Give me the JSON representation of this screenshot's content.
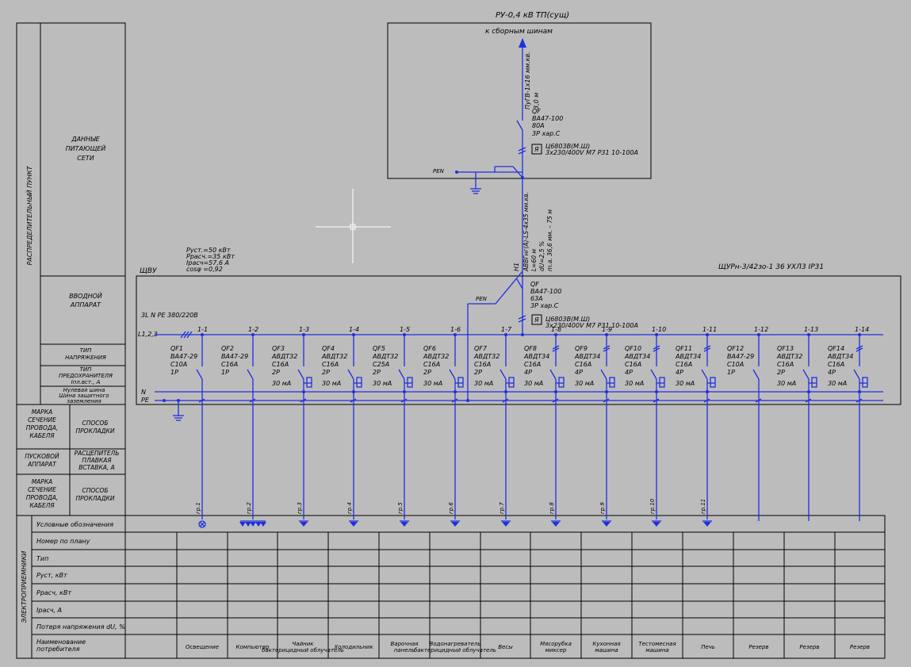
{
  "colors": {
    "background": "#bcbcbc",
    "line": "#000000",
    "network": "#1f2fe0",
    "cursor": "#ffffff"
  },
  "title_block": {
    "ru_title": "РУ-0,4 кВ ТП(сущ)",
    "busbar_label": "к сборным шинам",
    "feed_cable": [
      "ПуГВ-1х16 мм.кв.",
      "3,0 м"
    ],
    "feed_qf": [
      "QF",
      "ВА47-100",
      "80А",
      "3P хар.С"
    ],
    "feed_meter": [
      "Ц6803В(М.Ш)",
      "3х230/400V М7 Р31 10-100А"
    ],
    "pen_top": "PEN",
    "main_cable": [
      "АВВГнг(А)-LS-4х35 мм.кв.",
      "L=60 м",
      "dU=2,5 %",
      "m.a. 36,6 мм. – 75 м"
    ],
    "h1": "H1"
  },
  "load_calc": [
    "Руст.=50 кВт",
    "Ррасч.=35 кВт",
    "Iрасч=57,6 А",
    "cosφ =0,92"
  ],
  "panel": {
    "name": "ЩВУ",
    "type": "ЩУРн-3/42зо-1 36 УХЛ3 IP31",
    "voltage": "3L N PE   380/220В",
    "bus_label": "L1,2,3",
    "n_label": "N",
    "pe_label": "PE",
    "pen": "PEN",
    "input_qf": [
      "QF",
      "ВА47-100",
      "63А",
      "3P хар.С"
    ],
    "input_meter": [
      "Ц6803В(М.Ш)",
      "3х230/400V М7 Р31 10-100А"
    ]
  },
  "feeders": [
    {
      "num": "1-1",
      "qf": "QF1",
      "model": "ВА47-29",
      "rating": "C10A",
      "poles": "1P",
      "ma": "",
      "cable": "гр.1",
      "consumer": "Освещение"
    },
    {
      "num": "1-2",
      "qf": "QF2",
      "model": "ВА47-29",
      "rating": "C16A",
      "poles": "1P",
      "ma": "",
      "cable": "гр.2",
      "consumer": "Компьютер"
    },
    {
      "num": "1-3",
      "qf": "QF3",
      "model": "АВДТ32",
      "rating": "C16A",
      "poles": "2P",
      "ma": "30 мА",
      "cable": "гр.3",
      "consumer": "Чайник, бактерицидный облучатель"
    },
    {
      "num": "1-4",
      "qf": "QF4",
      "model": "АВДТ32",
      "rating": "C16A",
      "poles": "2P",
      "ma": "30 мА",
      "cable": "гр.4",
      "consumer": "Холодильник"
    },
    {
      "num": "1-5",
      "qf": "QF5",
      "model": "АВДТ32",
      "rating": "C25A",
      "poles": "2P",
      "ma": "30 мА",
      "cable": "гр.5",
      "consumer": "Варочная панель"
    },
    {
      "num": "1-6",
      "qf": "QF6",
      "model": "АВДТ32",
      "rating": "C16A",
      "poles": "2P",
      "ma": "30 мА",
      "cable": "гр.6",
      "consumer": "Водонагреватель, бактерицидный облучатель"
    },
    {
      "num": "1-7",
      "qf": "QF7",
      "model": "АВДТ32",
      "rating": "C16A",
      "poles": "2P",
      "ma": "30 мА",
      "cable": "гр.7",
      "consumer": "Весы"
    },
    {
      "num": "1-8",
      "qf": "QF8",
      "model": "АВДТ34",
      "rating": "C16A",
      "poles": "4P",
      "ma": "30 мА",
      "cable": "гр.8",
      "consumer": "Мясорубка, миксер"
    },
    {
      "num": "1-9",
      "qf": "QF9",
      "model": "АВДТ34",
      "rating": "C16A",
      "poles": "4P",
      "ma": "30 мА",
      "cable": "гр.9",
      "consumer": "Кухонная машина"
    },
    {
      "num": "1-10",
      "qf": "QF10",
      "model": "АВДТ34",
      "rating": "C16A",
      "poles": "4P",
      "ma": "30 мА",
      "cable": "гр.10",
      "consumer": "Тестомесная машина"
    },
    {
      "num": "1-11",
      "qf": "QF11",
      "model": "АВДТ34",
      "rating": "C16A",
      "poles": "4P",
      "ma": "30 мА",
      "cable": "гр.11",
      "consumer": "Печь"
    },
    {
      "num": "1-12",
      "qf": "QF12",
      "model": "ВА47-29",
      "rating": "C10A",
      "poles": "1P",
      "ma": "",
      "cable": "",
      "consumer": "Резерв"
    },
    {
      "num": "1-13",
      "qf": "QF13",
      "model": "АВДТ32",
      "rating": "C16A",
      "poles": "2P",
      "ma": "30 мА",
      "cable": "",
      "consumer": "Резерв"
    },
    {
      "num": "1-14",
      "qf": "QF14",
      "model": "АВДТ34",
      "rating": "C16A",
      "poles": "4P",
      "ma": "30 мА",
      "cable": "",
      "consumer": "Резерв"
    }
  ],
  "left_column": {
    "network_vertical": "РАСПРЕДЕЛИТЕЛЬНЫЙ ПУНКТ",
    "network_data": "ДАННЫЕ ПИТАЮЩЕЙ СЕТИ",
    "input_device": "ВВОДНОЙ АППАРАТ",
    "voltage_type": "ТИП НАПРЯЖЕНИЯ",
    "fuse_type": "ТИП ПРЕДОХРАНИТЕЛЯ Iпл.вст., А",
    "neutral_bus": "Нулевая шина Шина защитного заземления",
    "cable_mark": "МАРКА СЕЧЕНИЕ ПРОВОДА, КАБЕЛЯ",
    "laying_method": "СПОСОБ ПРОКЛАДКИ",
    "start_device": "ПУСКОВОЙ АППАРАТ",
    "fuse_link": "РАСЦЕПИТЕЛЬ ПЛАВКАЯ ВСТАВКА, А",
    "cable_mark2": "МАРКА СЕЧЕНИЕ ПРОВОДА, КАБЕЛЯ",
    "laying_method2": "СПОСОБ ПРОКЛАДКИ",
    "consumers_vertical": "ЭЛЕКТРОПРИЕМНИКИ"
  },
  "consumer_table": {
    "rows": [
      "Условные обозначения",
      "Номер по плану",
      "Тип",
      "Руст,   кВт",
      "Ррасч,   кВт",
      "Iрасч,   А",
      "Потеря напряжения dU, %",
      "Наименование потребителя"
    ]
  }
}
